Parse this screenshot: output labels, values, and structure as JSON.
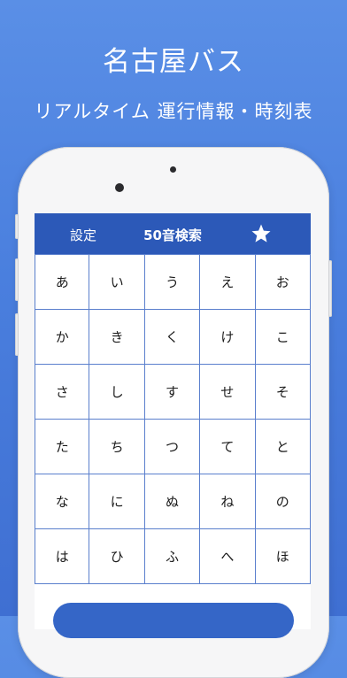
{
  "promo": {
    "title": "名古屋バス",
    "subtitle": "リアルタイム 運行情報・時刻表"
  },
  "colors": {
    "background": "#4a7fde",
    "nav_bar": "#2c59b8",
    "grid_line": "#5a7fcd",
    "star": "#ffffff"
  },
  "nav": {
    "settings_label": "設定",
    "title": "50音検索",
    "favorites_icon": "star-icon"
  },
  "kana_rows": [
    [
      "あ",
      "い",
      "う",
      "え",
      "お"
    ],
    [
      "か",
      "き",
      "く",
      "け",
      "こ"
    ],
    [
      "さ",
      "し",
      "す",
      "せ",
      "そ"
    ],
    [
      "た",
      "ち",
      "つ",
      "て",
      "と"
    ],
    [
      "な",
      "に",
      "ぬ",
      "ね",
      "の"
    ],
    [
      "は",
      "ひ",
      "ふ",
      "へ",
      "ほ"
    ]
  ]
}
